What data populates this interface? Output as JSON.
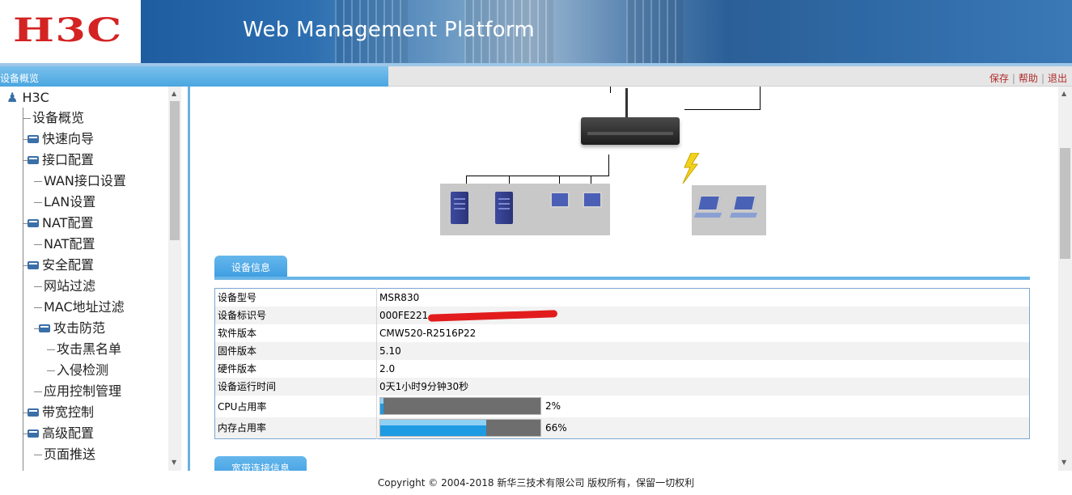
{
  "header": {
    "logo_text": "H3C",
    "platform_title": "Web Management Platform"
  },
  "statusbar": {
    "breadcrumb": "设备概览",
    "links": {
      "save": "保存",
      "help": "帮助",
      "logout": "退出"
    }
  },
  "sidebar": {
    "root": "H3C",
    "items": [
      {
        "label": "设备概览"
      },
      {
        "label": "快速向导"
      },
      {
        "label": "接口配置"
      },
      {
        "label": "WAN接口设置"
      },
      {
        "label": "LAN设置"
      },
      {
        "label": "NAT配置"
      },
      {
        "label": "NAT配置"
      },
      {
        "label": "安全配置"
      },
      {
        "label": "网站过滤"
      },
      {
        "label": "MAC地址过滤"
      },
      {
        "label": "攻击防范"
      },
      {
        "label": "攻击黑名单"
      },
      {
        "label": "入侵检测"
      },
      {
        "label": "应用控制管理"
      },
      {
        "label": "带宽控制"
      },
      {
        "label": "高级配置"
      },
      {
        "label": "页面推送"
      }
    ]
  },
  "device_info": {
    "tab_label": "设备信息",
    "rows": [
      {
        "label": "设备型号",
        "value": "MSR830"
      },
      {
        "label": "设备标识号",
        "value": "000FE221"
      },
      {
        "label": "软件版本",
        "value": "CMW520-R2516P22"
      },
      {
        "label": "固件版本",
        "value": "5.10"
      },
      {
        "label": "硬件版本",
        "value": "2.0"
      },
      {
        "label": "设备运行时间",
        "value": "0天1小时9分钟30秒"
      }
    ],
    "cpu": {
      "label": "CPU占用率",
      "percent_text": "2%",
      "value": 2
    },
    "memory": {
      "label": "内存占用率",
      "percent_text": "66%",
      "value": 66
    }
  },
  "next_tab_label": "宽带连接信息",
  "footer": {
    "copyright": "Copyright © 2004-2018 新华三技术有限公司 版权所有，保留一切权利"
  },
  "colors": {
    "logo_red": "#d42323",
    "accent_blue": "#3a9be0",
    "link_red": "#b02c2c"
  }
}
